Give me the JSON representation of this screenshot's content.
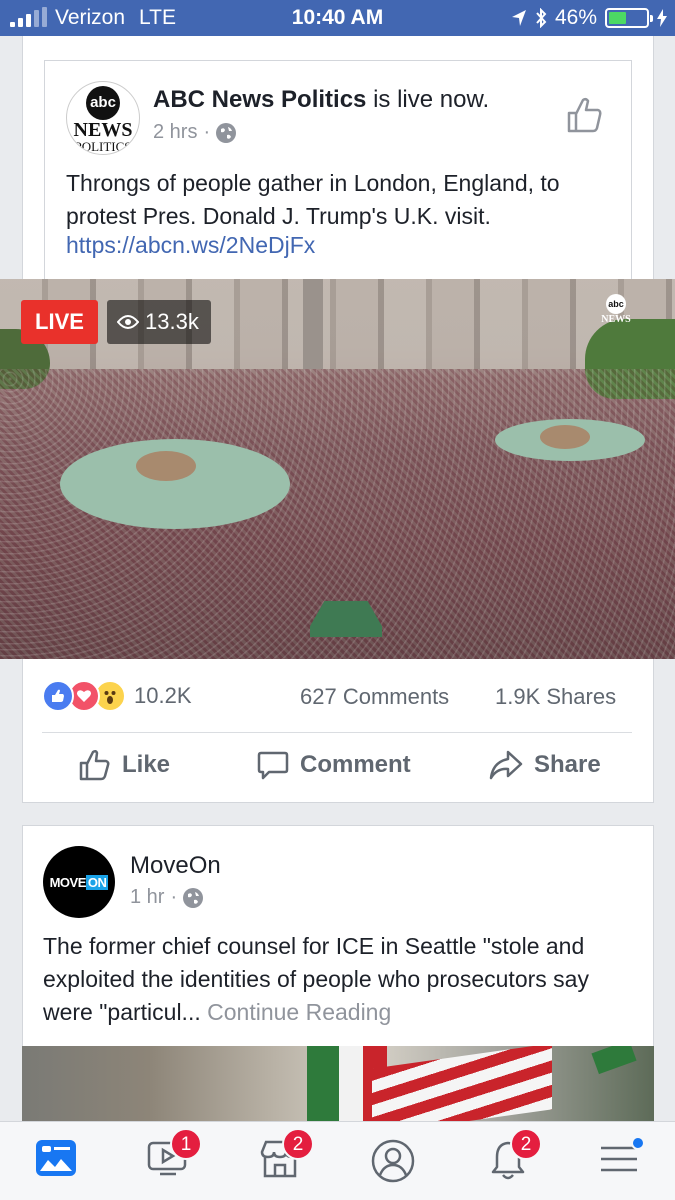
{
  "status": {
    "carrier": "Verizon",
    "network": "LTE",
    "time": "10:40 AM",
    "battery": "46%",
    "battery_level": 0.46
  },
  "post1": {
    "shared": {
      "page_name": "ABC News Politics",
      "action_text": "is live now.",
      "time": "2 hrs",
      "avatar_text": {
        "logo": "abc",
        "line1": "NEWS",
        "line2": "POLITICS"
      },
      "text": "Throngs of people gather in London, England, to protest Pres. Donald J. Trump's U.K. visit.",
      "link": "https://abcn.ws/2NeDjFx"
    },
    "video": {
      "live_label": "LIVE",
      "viewers": "13.3k",
      "bug_logo": "abc",
      "bug_text": "NEWS"
    },
    "reactions_count": "10.2K",
    "comments": "627 Comments",
    "shares": "1.9K Shares",
    "actions": {
      "like": "Like",
      "comment": "Comment",
      "share": "Share"
    }
  },
  "post2": {
    "page_name": "MoveOn",
    "avatar_text": {
      "move": "MOVE",
      "on": "ON"
    },
    "time": "1 hr",
    "text": "The former chief counsel for ICE in Seattle \"stole and exploited the identities of people who prosecutors say were \"particul...",
    "continue": "Continue Reading"
  },
  "tabbar": {
    "watch_badge": "1",
    "marketplace_badge": "2",
    "notifications_badge": "2"
  },
  "colors": {
    "brand": "#4267b2",
    "live": "#e9312b",
    "badge": "#e41e3f",
    "link": "#4267b2"
  }
}
